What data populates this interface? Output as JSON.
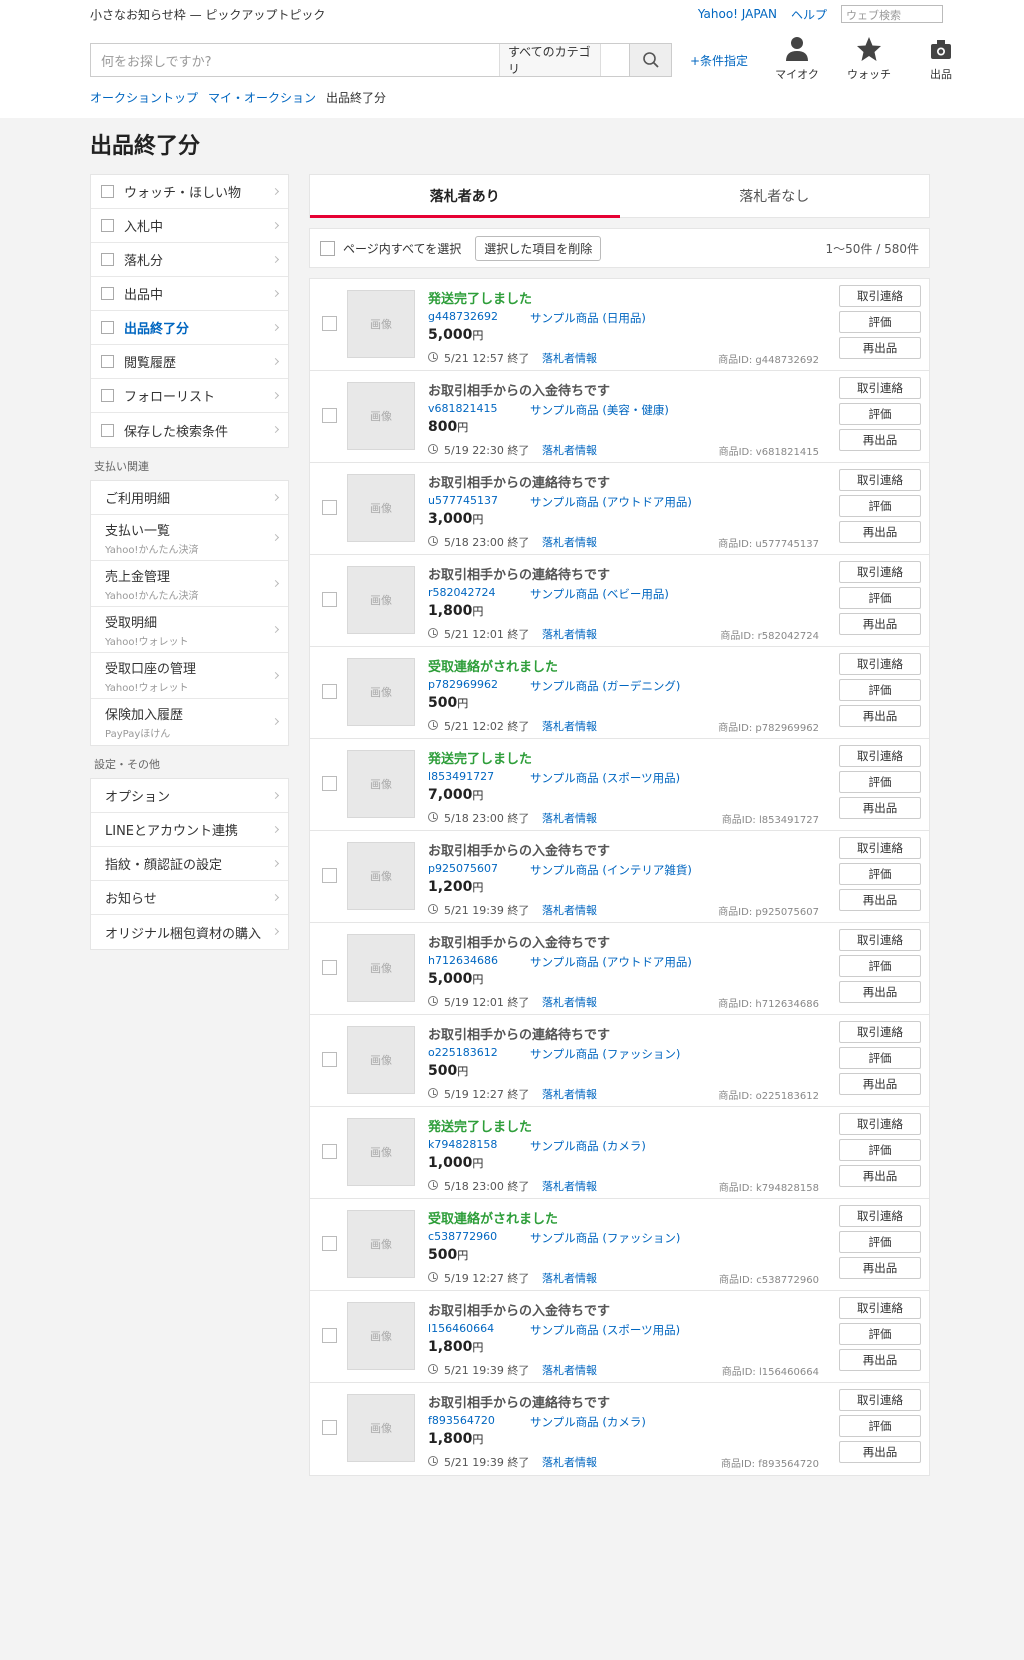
{
  "topbar": {
    "promo": "小さなお知らせ枠 — ピックアップトピック",
    "yahoo_japan": "Yahoo! JAPAN",
    "help": "ヘルプ",
    "web_search_placeholder": "ウェブ検索"
  },
  "header": {
    "search_placeholder": "何をお探しですか?",
    "category": "すべてのカテゴリ",
    "advanced": "+条件指定",
    "icons": [
      {
        "label": "マイオク"
      },
      {
        "label": "ウォッチ"
      },
      {
        "label": "出品"
      }
    ]
  },
  "breadcrumb": {
    "items": [
      "オークショントップ",
      "マイ・オークション",
      "出品終了分"
    ]
  },
  "page_title": "出品終了分",
  "sidebar": {
    "group1": [
      {
        "label": "ウォッチ・ほしい物"
      },
      {
        "label": "入札中"
      },
      {
        "label": "落札分"
      },
      {
        "label": "出品中"
      },
      {
        "label": "出品終了分"
      },
      {
        "label": "閲覧履歴"
      },
      {
        "label": "フォローリスト"
      },
      {
        "label": "保存した検索条件"
      }
    ],
    "payment_heading": "支払い関連",
    "payment": [
      {
        "label": "ご利用明細",
        "sub": ""
      },
      {
        "label": "支払い一覧",
        "sub": "Yahoo!かんたん決済"
      },
      {
        "label": "売上金管理",
        "sub": "Yahoo!かんたん決済"
      },
      {
        "label": "受取明細",
        "sub": "Yahoo!ウォレット"
      },
      {
        "label": "受取口座の管理",
        "sub": "Yahoo!ウォレット"
      },
      {
        "label": "保険加入履歴",
        "sub": "PayPayほけん"
      }
    ],
    "settings_heading": "設定・その他",
    "settings": [
      {
        "label": "オプション"
      },
      {
        "label": "LINEとアカウント連携"
      },
      {
        "label": "指紋・顔認証の設定"
      },
      {
        "label": "お知らせ"
      },
      {
        "label": "オリジナル梱包資材の購入"
      }
    ]
  },
  "tabs": [
    {
      "label": "落札者あり"
    },
    {
      "label": "落札者なし"
    }
  ],
  "toolbar": {
    "select_all": "ページ内すべてを選択",
    "delete_selected": "選択した項目を削除",
    "count": "1〜50件 / 580件"
  },
  "item_labels": {
    "thumb": "画像",
    "winner": "落札者情報",
    "contact": "取引連絡",
    "rate": "評価",
    "relist": "再出品",
    "yen": "円"
  },
  "items": [
    {
      "status": "発送完了しました",
      "green": true,
      "id": "g448732692",
      "name": "サンプル商品 (日用品)",
      "price": "5,000",
      "end": "5/21 12:57 終了",
      "pid": "商品ID: g448732692"
    },
    {
      "status": "お取引相手からの入金待ちです",
      "green": false,
      "id": "v681821415",
      "name": "サンプル商品 (美容・健康)",
      "price": "800",
      "end": "5/19 22:30 終了",
      "pid": "商品ID: v681821415"
    },
    {
      "status": "お取引相手からの連絡待ちです",
      "green": false,
      "id": "u577745137",
      "name": "サンプル商品 (アウトドア用品)",
      "price": "3,000",
      "end": "5/18 23:00 終了",
      "pid": "商品ID: u577745137"
    },
    {
      "status": "お取引相手からの連絡待ちです",
      "green": false,
      "id": "r582042724",
      "name": "サンプル商品 (ベビー用品)",
      "price": "1,800",
      "end": "5/21 12:01 終了",
      "pid": "商品ID: r582042724"
    },
    {
      "status": "受取連絡がされました",
      "green": true,
      "id": "p782969962",
      "name": "サンプル商品 (ガーデニング)",
      "price": "500",
      "end": "5/21 12:02 終了",
      "pid": "商品ID: p782969962"
    },
    {
      "status": "発送完了しました",
      "green": true,
      "id": "l853491727",
      "name": "サンプル商品 (スポーツ用品)",
      "price": "7,000",
      "end": "5/18 23:00 終了",
      "pid": "商品ID: l853491727"
    },
    {
      "status": "お取引相手からの入金待ちです",
      "green": false,
      "id": "p925075607",
      "name": "サンプル商品 (インテリア雑貨)",
      "price": "1,200",
      "end": "5/21 19:39 終了",
      "pid": "商品ID: p925075607"
    },
    {
      "status": "お取引相手からの入金待ちです",
      "green": false,
      "id": "h712634686",
      "name": "サンプル商品 (アウトドア用品)",
      "price": "5,000",
      "end": "5/19 12:01 終了",
      "pid": "商品ID: h712634686"
    },
    {
      "status": "お取引相手からの連絡待ちです",
      "green": false,
      "id": "o225183612",
      "name": "サンプル商品 (ファッション)",
      "price": "500",
      "end": "5/19 12:27 終了",
      "pid": "商品ID: o225183612"
    },
    {
      "status": "発送完了しました",
      "green": true,
      "id": "k794828158",
      "name": "サンプル商品 (カメラ)",
      "price": "1,000",
      "end": "5/18 23:00 終了",
      "pid": "商品ID: k794828158"
    },
    {
      "status": "受取連絡がされました",
      "green": true,
      "id": "c538772960",
      "name": "サンプル商品 (ファッション)",
      "price": "500",
      "end": "5/19 12:27 終了",
      "pid": "商品ID: c538772960"
    },
    {
      "status": "お取引相手からの入金待ちです",
      "green": false,
      "id": "l156460664",
      "name": "サンプル商品 (スポーツ用品)",
      "price": "1,800",
      "end": "5/21 19:39 終了",
      "pid": "商品ID: l156460664"
    },
    {
      "status": "お取引相手からの連絡待ちです",
      "green": false,
      "id": "f893564720",
      "name": "サンプル商品 (カメラ)",
      "price": "1,800",
      "end": "5/21 19:39 終了",
      "pid": "商品ID: f893564720"
    }
  ],
  "colors": {
    "link": "#0066c0",
    "green_status": "#2e9e3a",
    "tab_accent": "#e60033"
  }
}
